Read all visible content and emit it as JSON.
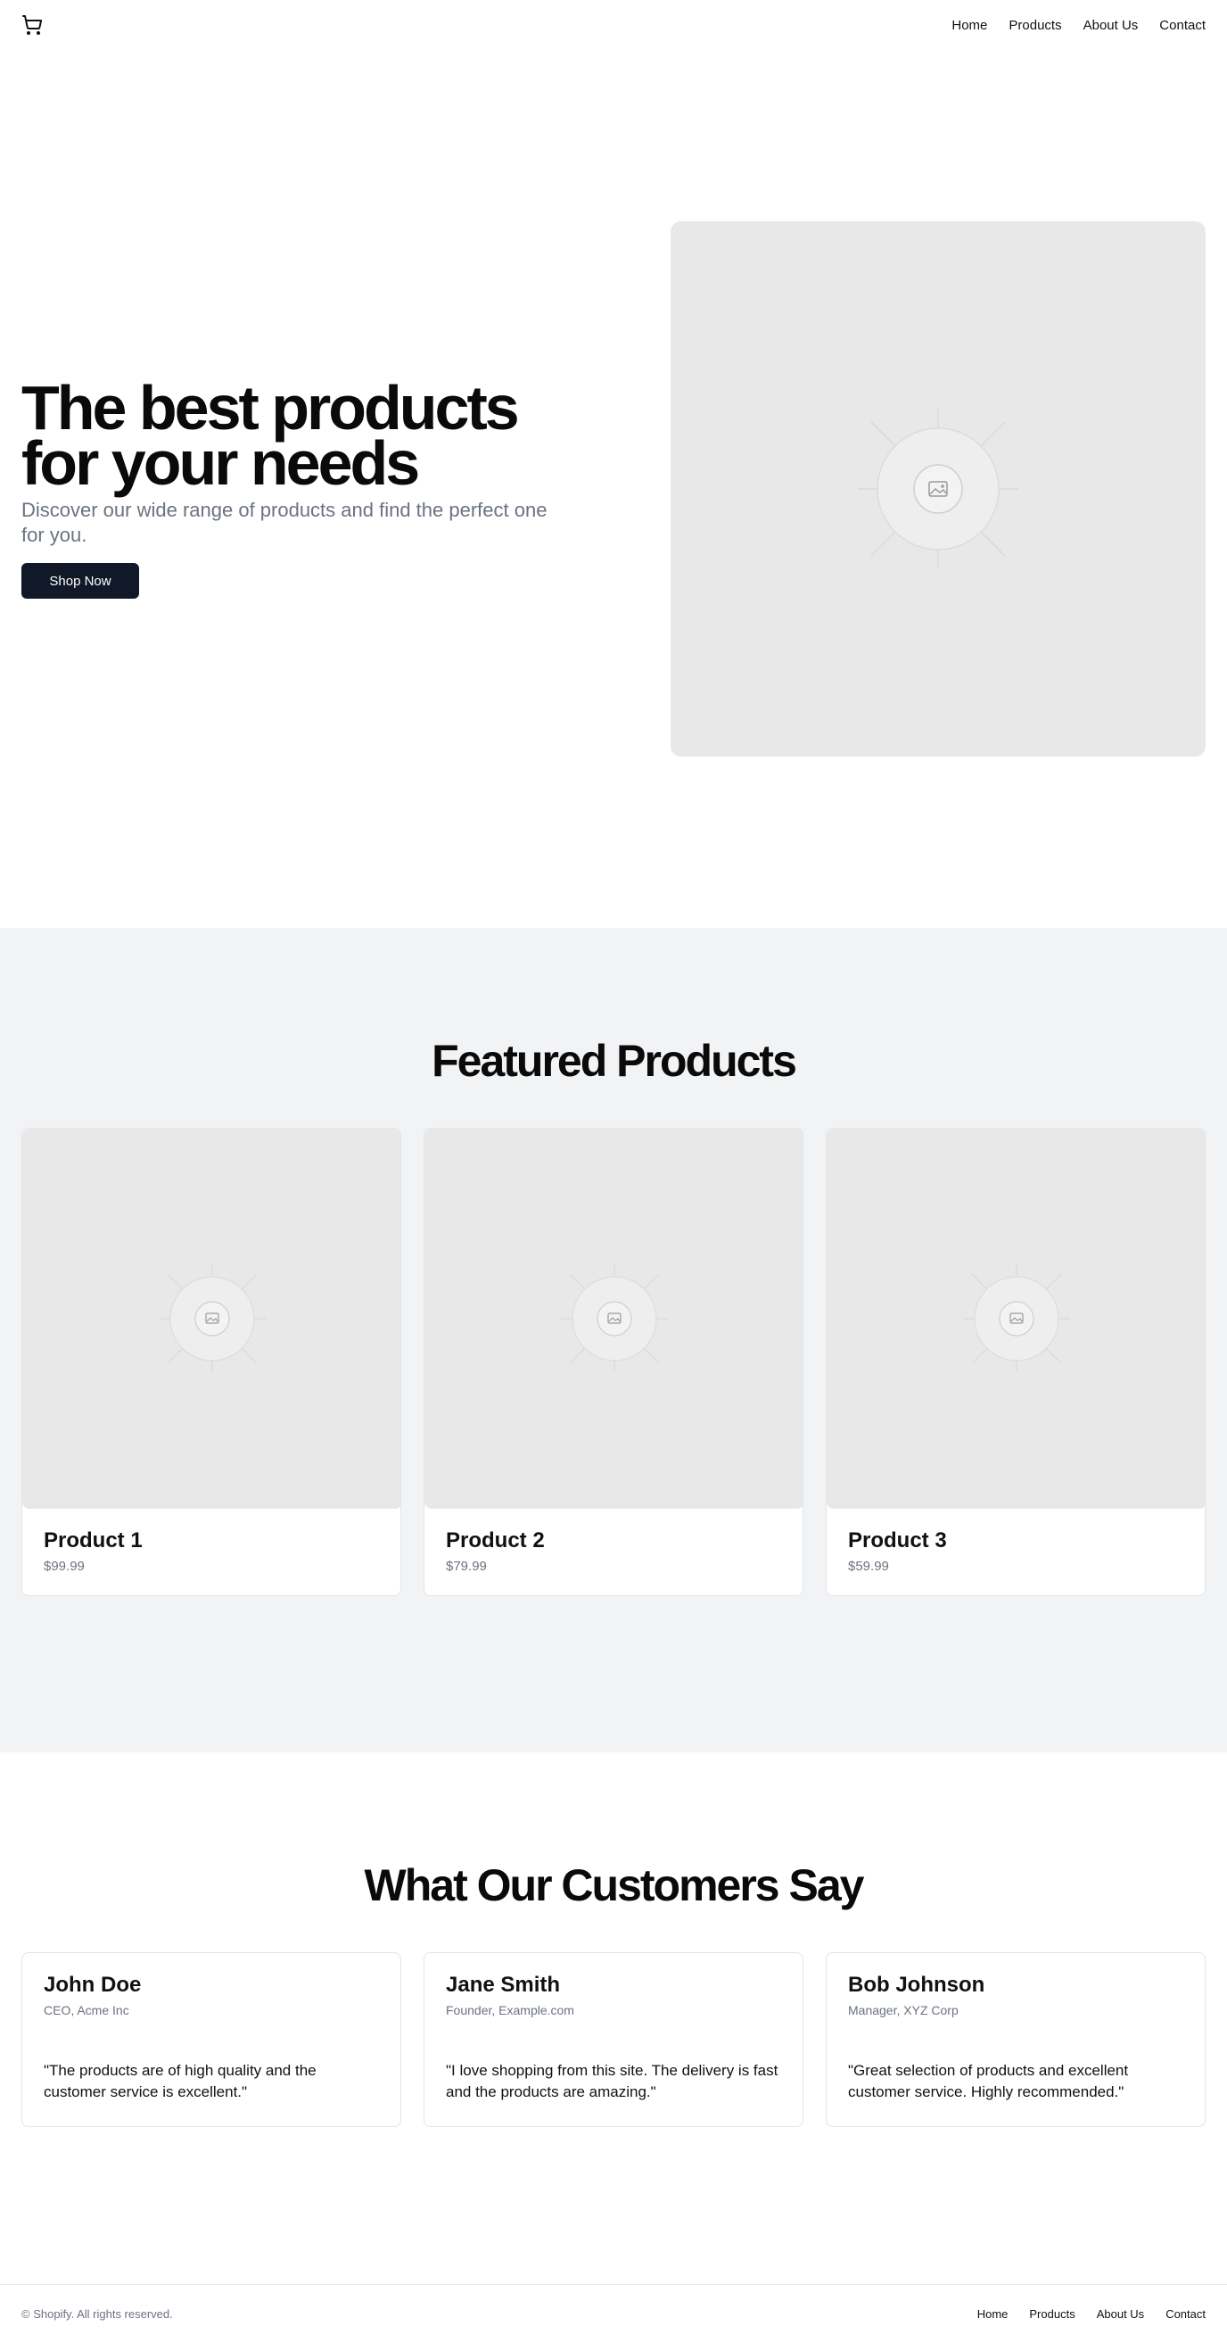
{
  "header": {
    "logo_icon": "shopping-cart-icon",
    "nav": [
      "Home",
      "Products",
      "About Us",
      "Contact"
    ]
  },
  "hero": {
    "title": "The best products for your needs",
    "subtitle": "Discover our wide range of products and find the perfect one for you.",
    "cta": "Shop Now",
    "image_icon": "image-placeholder-icon"
  },
  "featured": {
    "title": "Featured Products",
    "products": [
      {
        "name": "Product 1",
        "price": "$99.99"
      },
      {
        "name": "Product 2",
        "price": "$79.99"
      },
      {
        "name": "Product 3",
        "price": "$59.99"
      }
    ]
  },
  "testimonials": {
    "title": "What Our Customers Say",
    "items": [
      {
        "name": "John Doe",
        "role": "CEO, Acme Inc",
        "quote": "\"The products are of high quality and the customer service is excellent.\""
      },
      {
        "name": "Jane Smith",
        "role": "Founder, Example.com",
        "quote": "\"I love shopping from this site. The delivery is fast and the products are amazing.\""
      },
      {
        "name": "Bob Johnson",
        "role": "Manager, XYZ Corp",
        "quote": "\"Great selection of products and excellent customer service. Highly recommended.\""
      }
    ]
  },
  "footer": {
    "copyright": "© Shopify. All rights reserved.",
    "nav": [
      "Home",
      "Products",
      "About Us",
      "Contact"
    ]
  },
  "colors": {
    "primary_button": "#111827",
    "muted_text": "#6b7280",
    "section_bg": "#f2f3f5",
    "placeholder_bg": "#e8e8e8"
  }
}
